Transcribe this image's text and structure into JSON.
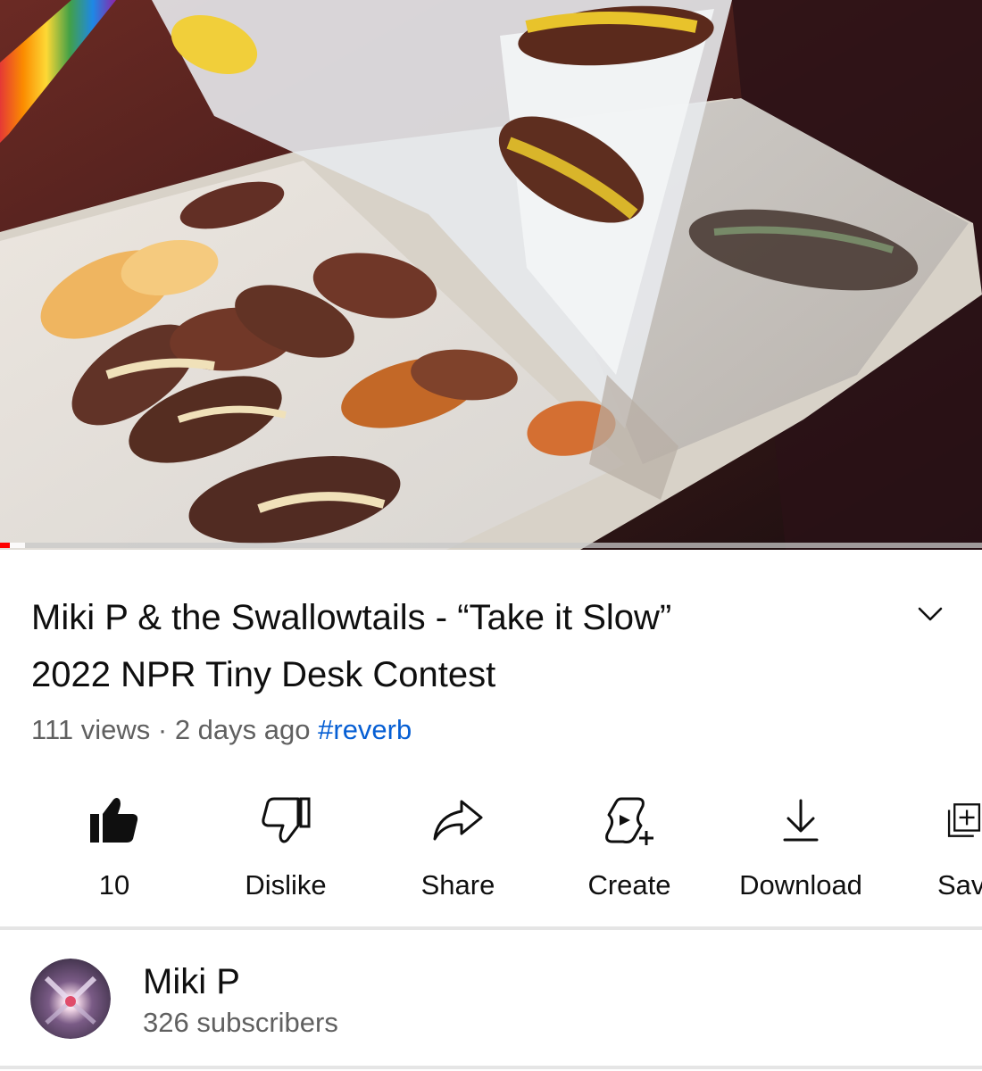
{
  "video": {
    "title_line1": "Miki P & the Swallowtails - “Take it Slow”",
    "title_line2": "2022 NPR Tiny Desk Contest",
    "views": "111 views",
    "separator": "·",
    "age": "2 days ago",
    "hashtag": "#reverb",
    "progress_fraction": 0.01,
    "buffer_fraction": 0.025
  },
  "actions": {
    "like_count": "10",
    "dislike_label": "Dislike",
    "share_label": "Share",
    "create_label": "Create",
    "download_label": "Download",
    "save_label": "Save"
  },
  "channel": {
    "name": "Miki P",
    "subscribers": "326 subscribers"
  },
  "colors": {
    "progress": "#ff0000",
    "hashtag": "#065fd4",
    "secondary_text": "#606060",
    "primary_text": "#0f0f0f"
  },
  "icons": {
    "like": "thumbs-up-filled-icon",
    "dislike": "thumbs-down-outline-icon",
    "share": "share-arrow-icon",
    "create": "create-remix-icon",
    "download": "download-icon",
    "save": "save-playlist-icon",
    "expand": "chevron-down-icon"
  }
}
